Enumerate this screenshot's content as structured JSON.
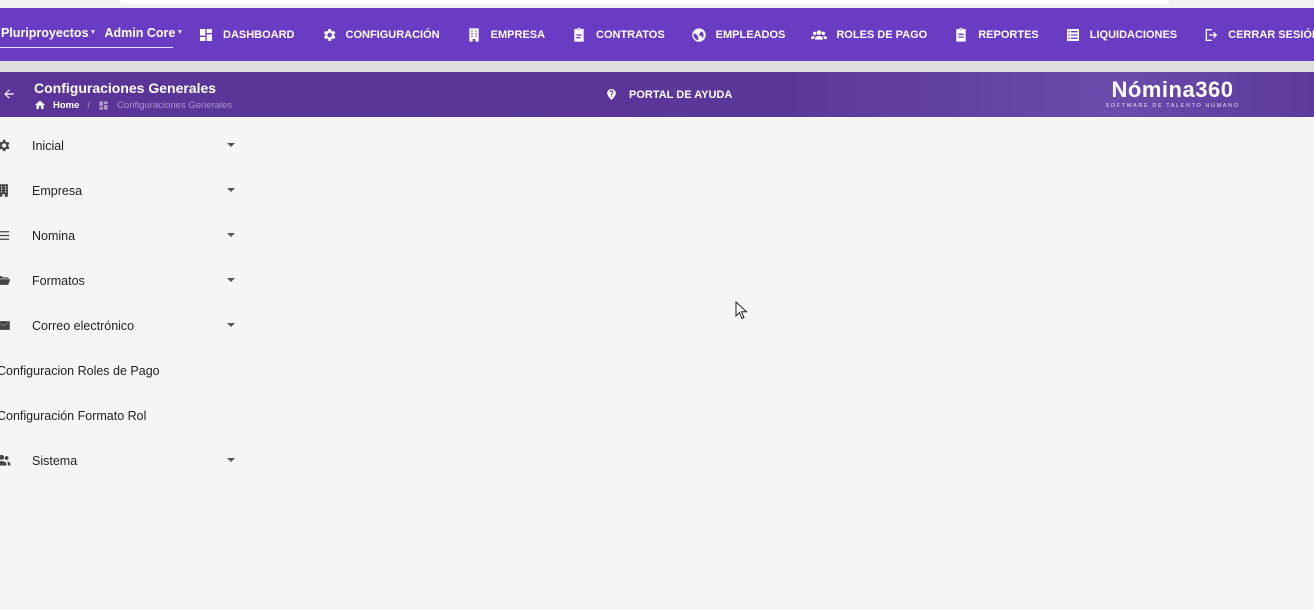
{
  "topbar": {
    "company_selector": "Pluriproyectos",
    "role_selector": "Admin Core",
    "nav": [
      {
        "label": "DASHBOARD",
        "icon": "dashboard-icon"
      },
      {
        "label": "CONFIGURACIÓN",
        "icon": "gear-icon"
      },
      {
        "label": "EMPRESA",
        "icon": "building-icon"
      },
      {
        "label": "CONTRATOS",
        "icon": "clipboard-icon"
      },
      {
        "label": "EMPLEADOS",
        "icon": "globe-icon"
      },
      {
        "label": "ROLES DE PAGO",
        "icon": "users-icon"
      },
      {
        "label": "REPORTES",
        "icon": "report-icon"
      },
      {
        "label": "LIQUIDACIONES",
        "icon": "list-icon"
      },
      {
        "label": "CERRAR SESIÓN",
        "icon": "logout-icon"
      }
    ]
  },
  "subheader": {
    "title": "Configuraciones Generales",
    "breadcrumb_home": "Home",
    "breadcrumb_separator": "/",
    "breadcrumb_current": "Configuraciones Generales",
    "help_label": "PORTAL DE AYUDA",
    "logo_name": "Nómina360",
    "logo_tagline": "SOFTWARE DE TALENTO HUMANO"
  },
  "sidebar": {
    "items": [
      {
        "label": "Inicial",
        "icon": "gear-icon",
        "expandable": true
      },
      {
        "label": "Empresa",
        "icon": "building-icon",
        "expandable": true
      },
      {
        "label": "Nomina",
        "icon": "menu-icon",
        "expandable": true
      },
      {
        "label": "Formatos",
        "icon": "folder-icon",
        "expandable": true
      },
      {
        "label": "Correo electrónico",
        "icon": "envelope-icon",
        "expandable": true
      },
      {
        "label": "Configuracion Roles de Pago",
        "icon": "",
        "expandable": false
      },
      {
        "label": "Configuración Formato Rol",
        "icon": "",
        "expandable": false
      },
      {
        "label": "Sistema",
        "icon": "users-icon",
        "expandable": true
      }
    ]
  },
  "colors": {
    "navbar": "#6a3cc4",
    "subheader": "#5a3597",
    "background": "#f5f5f5"
  }
}
